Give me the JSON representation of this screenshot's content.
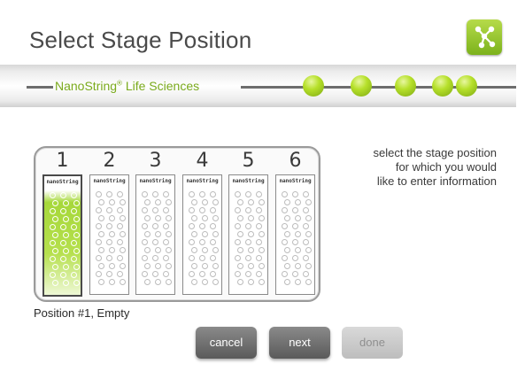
{
  "header": {
    "title": "Select Stage Position",
    "logo_icon": "network-nodes-icon"
  },
  "band": {
    "brand_name": "NanoString",
    "brand_mark": "®",
    "brand_suffix": "Life Sciences",
    "progress_step_count": 5,
    "accent_color": "#7aaa1c"
  },
  "tray": {
    "positions": [
      {
        "number": "1",
        "brand": "nanoString",
        "selected": true
      },
      {
        "number": "2",
        "brand": "nanoString",
        "selected": false
      },
      {
        "number": "3",
        "brand": "nanoString",
        "selected": false
      },
      {
        "number": "4",
        "brand": "nanoString",
        "selected": false
      },
      {
        "number": "5",
        "brand": "nanoString",
        "selected": false
      },
      {
        "number": "6",
        "brand": "nanoString",
        "selected": false
      }
    ]
  },
  "help": {
    "lines": [
      "select the stage position",
      "for which you would",
      "like to enter information"
    ]
  },
  "status": {
    "text": "Position #1, Empty"
  },
  "buttons": {
    "cancel": "cancel",
    "next": "next",
    "done": "done"
  }
}
